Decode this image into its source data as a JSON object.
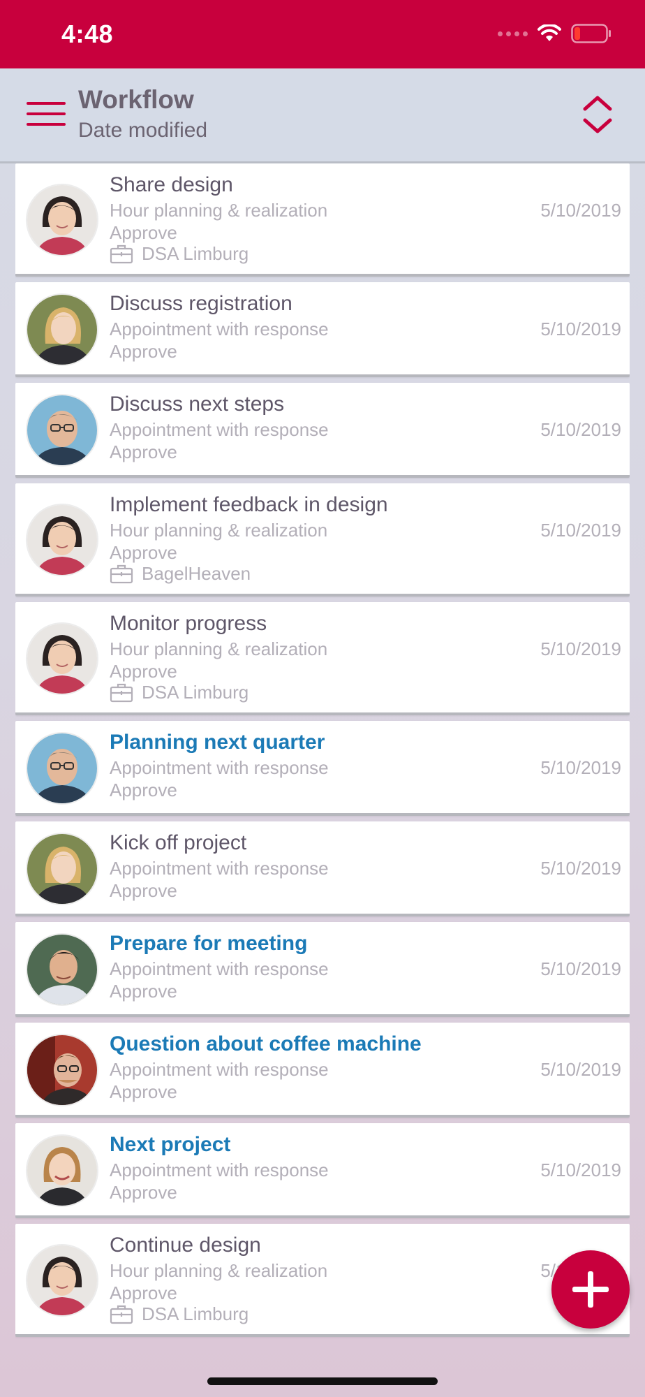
{
  "status_bar": {
    "time": "4:48"
  },
  "header": {
    "title": "Workflow",
    "subtitle": "Date modified"
  },
  "items": [
    {
      "title": "Share design",
      "type": "Hour planning & realization",
      "status": "Approve",
      "org": "DSA Limburg",
      "date": "5/10/2019",
      "unread": false,
      "avatar": "woman-asian"
    },
    {
      "title": "Discuss registration",
      "type": "Appointment with response",
      "status": "Approve",
      "org": "",
      "date": "5/10/2019",
      "unread": false,
      "avatar": "woman-blonde"
    },
    {
      "title": "Discuss next steps",
      "type": "Appointment with response",
      "status": "Approve",
      "org": "",
      "date": "5/10/2019",
      "unread": false,
      "avatar": "man-glasses"
    },
    {
      "title": "Implement feedback in design",
      "type": "Hour planning & realization",
      "status": "Approve",
      "org": "BagelHeaven",
      "date": "5/10/2019",
      "unread": false,
      "avatar": "woman-asian"
    },
    {
      "title": "Monitor progress",
      "type": "Hour planning & realization",
      "status": "Approve",
      "org": "DSA Limburg",
      "date": "5/10/2019",
      "unread": false,
      "avatar": "woman-asian"
    },
    {
      "title": "Planning next quarter",
      "type": "Appointment with response",
      "status": "Approve",
      "org": "",
      "date": "5/10/2019",
      "unread": true,
      "avatar": "man-glasses"
    },
    {
      "title": "Kick off project",
      "type": "Appointment with response",
      "status": "Approve",
      "org": "",
      "date": "5/10/2019",
      "unread": false,
      "avatar": "woman-blonde"
    },
    {
      "title": "Prepare for meeting",
      "type": "Appointment with response",
      "status": "Approve",
      "org": "",
      "date": "5/10/2019",
      "unread": true,
      "avatar": "man-dark"
    },
    {
      "title": "Question about coffee machine",
      "type": "Appointment with response",
      "status": "Approve",
      "org": "",
      "date": "5/10/2019",
      "unread": true,
      "avatar": "man-red"
    },
    {
      "title": "Next project",
      "type": "Appointment with response",
      "status": "Approve",
      "org": "",
      "date": "5/10/2019",
      "unread": true,
      "avatar": "woman-smile"
    },
    {
      "title": "Continue design",
      "type": "Hour planning & realization",
      "status": "Approve",
      "org": "DSA Limburg",
      "date": "5/10/2019",
      "unread": false,
      "avatar": "woman-asian"
    }
  ],
  "colors": {
    "brand": "#c8003d",
    "unread_title": "#1b7ab6",
    "title": "#5e5668",
    "secondary": "#b3afb8"
  },
  "icons": {
    "menu": "hamburger-icon",
    "sort": "sort-updown-icon",
    "org": "briefcase-icon",
    "add": "plus-icon"
  }
}
